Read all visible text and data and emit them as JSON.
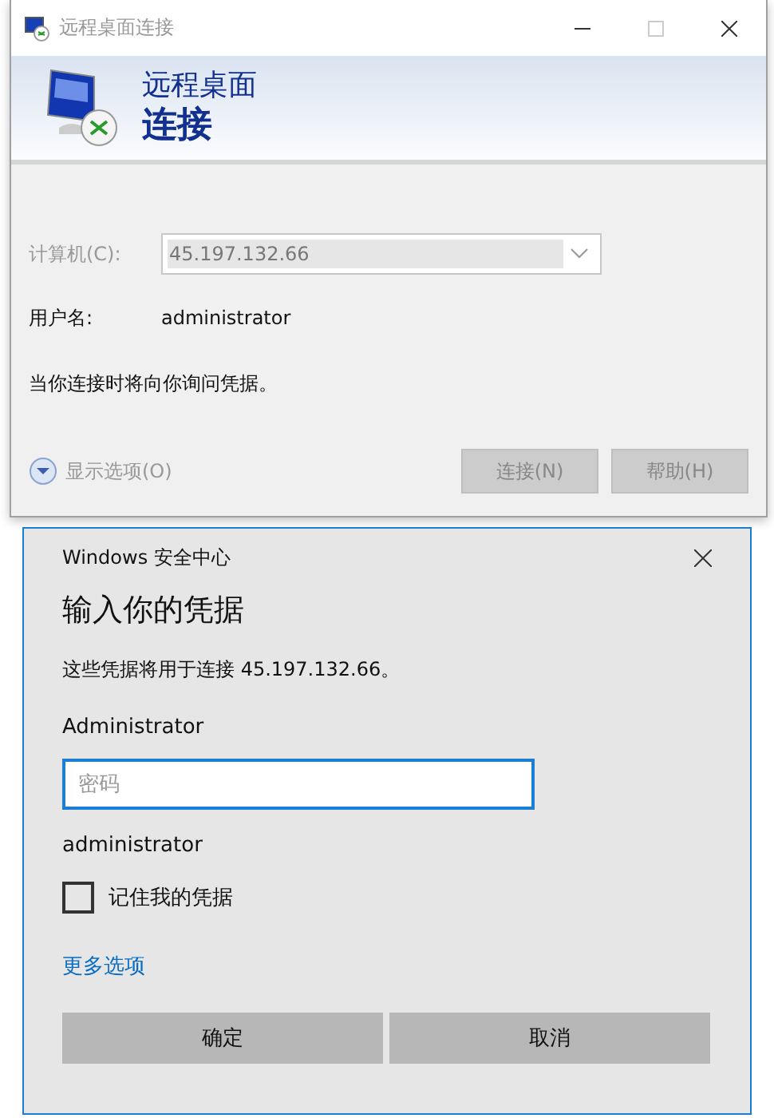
{
  "rdp_window": {
    "title": "远程桌面连接",
    "banner_line_1": "远程桌面",
    "banner_line_2": "连接",
    "computer": {
      "label": "计算机(C):",
      "value": "45.197.132.66",
      "disabled": true
    },
    "username": {
      "label": "用户名:",
      "value": "administrator"
    },
    "note": "当你连接时将向你询问凭据。",
    "options_toggle": {
      "label": "显示选项(O)",
      "expanded": false
    },
    "buttons": [
      {
        "label": "连接(N)",
        "disabled": true
      },
      {
        "label": "帮助(H)",
        "disabled": true
      }
    ]
  },
  "security_dialog": {
    "title": "Windows 安全中心",
    "heading": "输入你的凭据",
    "message": "这些凭据将用于连接 45.197.132.66。",
    "account": "Administrator",
    "password": {
      "placeholder": "密码"
    },
    "username": "administrator",
    "remember": {
      "label": "记住我的凭据",
      "checked": false
    },
    "more_link": "更多选项",
    "buttons": [
      {
        "label": "确定"
      },
      {
        "label": "取消"
      }
    ]
  }
}
